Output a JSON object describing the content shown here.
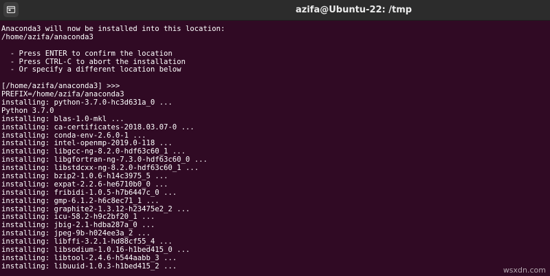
{
  "window": {
    "title": "azifa@Ubuntu-22: /tmp",
    "new_tab_icon": "terminal-tab-icon"
  },
  "colors": {
    "terminal_background": "#300a24",
    "terminal_text": "#ffffff",
    "titlebar_background": "#2c2c2c"
  },
  "terminal": {
    "lines": [
      "Anaconda3 will now be installed into this location:",
      "/home/azifa/anaconda3",
      "",
      "  - Press ENTER to confirm the location",
      "  - Press CTRL-C to abort the installation",
      "  - Or specify a different location below",
      "",
      "[/home/azifa/anaconda3] >>>",
      "PREFIX=/home/azifa/anaconda3",
      "installing: python-3.7.0-hc3d631a_0 ...",
      "Python 3.7.0",
      "installing: blas-1.0-mkl ...",
      "installing: ca-certificates-2018.03.07-0 ...",
      "installing: conda-env-2.6.0-1 ...",
      "installing: intel-openmp-2019.0-118 ...",
      "installing: libgcc-ng-8.2.0-hdf63c60_1 ...",
      "installing: libgfortran-ng-7.3.0-hdf63c60_0 ...",
      "installing: libstdcxx-ng-8.2.0-hdf63c60_1 ...",
      "installing: bzip2-1.0.6-h14c3975_5 ...",
      "installing: expat-2.2.6-he6710b0_0 ...",
      "installing: fribidi-1.0.5-h7b6447c_0 ...",
      "installing: gmp-6.1.2-h6c8ec71_1 ...",
      "installing: graphite2-1.3.12-h23475e2_2 ...",
      "installing: icu-58.2-h9c2bf20_1 ...",
      "installing: jbig-2.1-hdba287a_0 ...",
      "installing: jpeg-9b-h024ee3a_2 ...",
      "installing: libffi-3.2.1-hd88cf55_4 ...",
      "installing: libsodium-1.0.16-h1bed415_0 ...",
      "installing: libtool-2.4.6-h544aabb_3 ...",
      "installing: libuuid-1.0.3-h1bed415_2 ..."
    ]
  },
  "watermark": {
    "text": "wsxdn.com"
  }
}
